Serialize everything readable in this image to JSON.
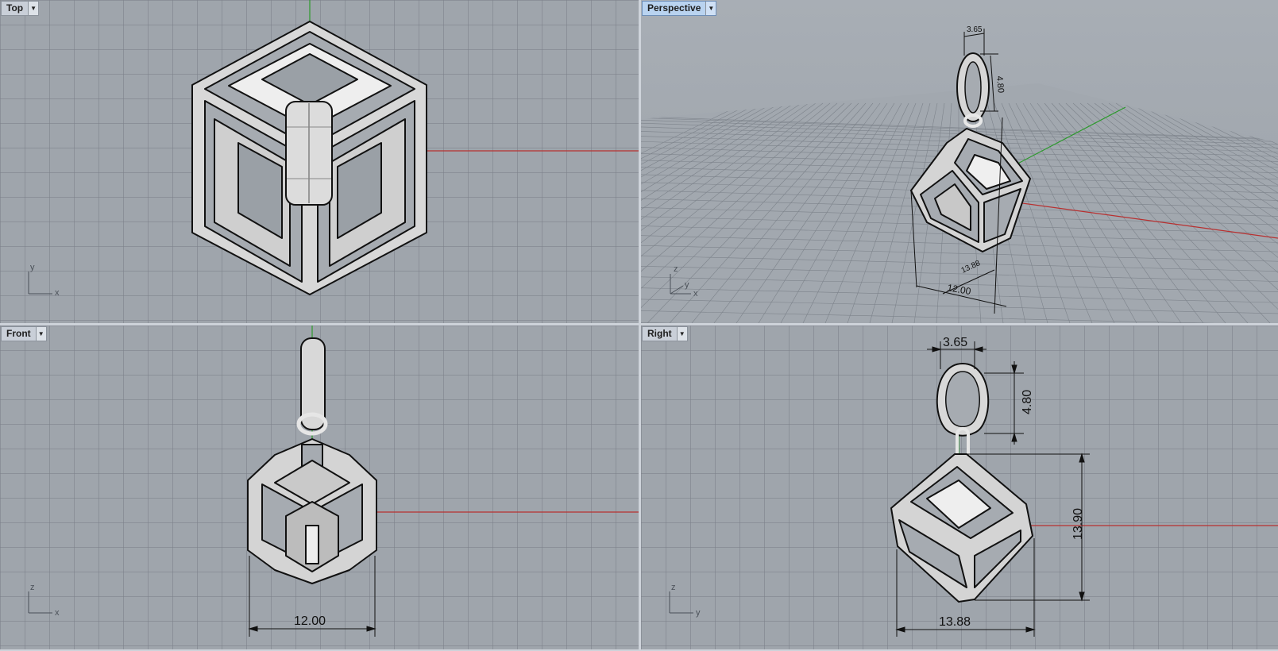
{
  "viewports": {
    "top": {
      "label": "Top",
      "axis_h": "x",
      "axis_v": "y"
    },
    "persp": {
      "label": "Perspective",
      "axis_h": "x",
      "axis_v": "z",
      "axis_d": "y"
    },
    "front": {
      "label": "Front",
      "axis_h": "x",
      "axis_v": "z",
      "dim_width": "12.00"
    },
    "right": {
      "label": "Right",
      "axis_h": "y",
      "axis_v": "z",
      "dim_bail_width": "3.65",
      "dim_bail_height": "4.80",
      "dim_cube_height": "13.90",
      "dim_cube_width": "13.88"
    }
  },
  "persp_dims": {
    "bail_width": "3.65",
    "bail_height": "4.80",
    "depth": "13.88",
    "width": "12.00"
  },
  "icons": {
    "viewport_menu": "chevron-down-icon"
  },
  "colors": {
    "viewport_bg": "#9fa5ac",
    "active_label": "#b9d3f0",
    "x_axis": "#b83030",
    "y_axis": "#2c9a2c"
  }
}
